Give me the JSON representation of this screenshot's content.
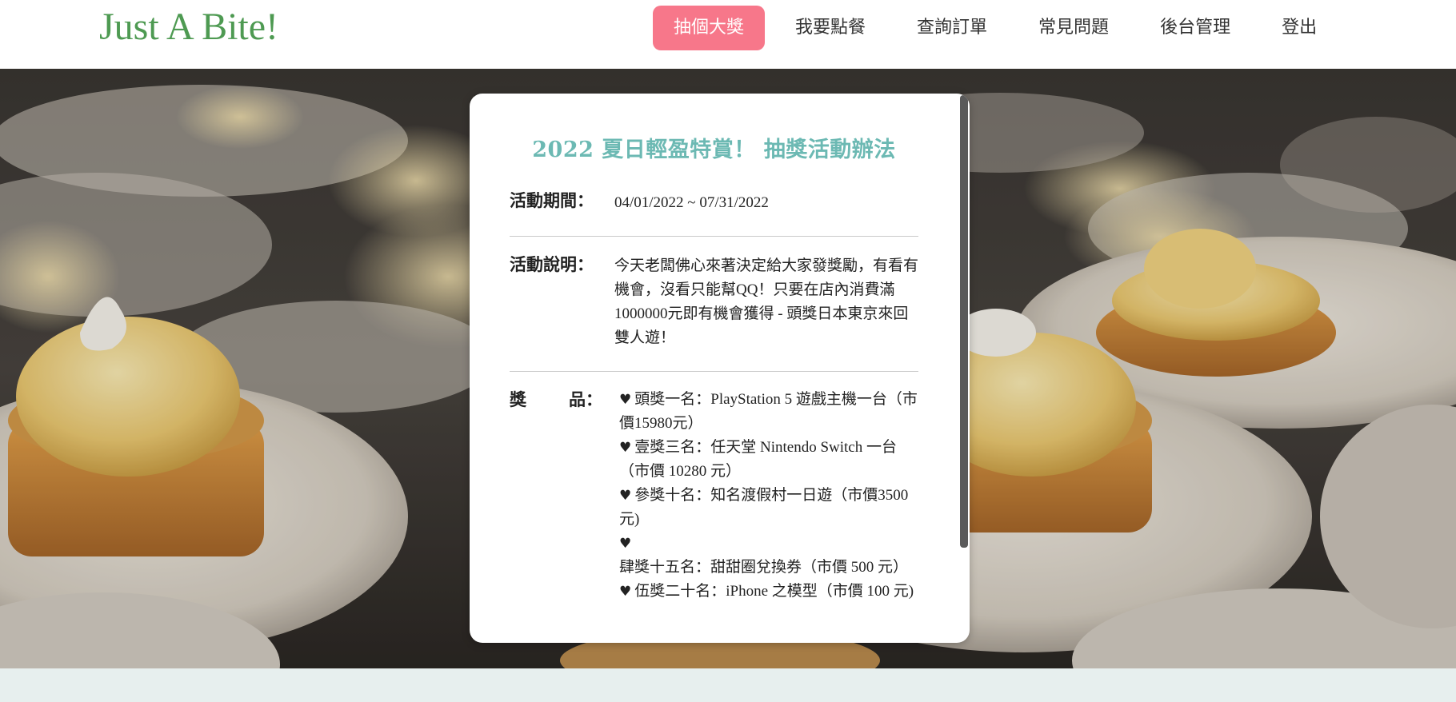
{
  "brand": {
    "name": "Just A Bite!"
  },
  "nav": {
    "items": [
      {
        "label": "抽個大獎",
        "active": true
      },
      {
        "label": "我要點餐",
        "active": false
      },
      {
        "label": "查詢訂單",
        "active": false
      },
      {
        "label": "常見問題",
        "active": false
      },
      {
        "label": "後台管理",
        "active": false
      },
      {
        "label": "登出",
        "active": false
      }
    ]
  },
  "hero": {
    "image": "lemon-tarts-on-plates-photo"
  },
  "card": {
    "title": "2022 夏日輕盈特賞！ 抽獎活動辦法",
    "period": {
      "label": "活動期間：",
      "value": "04/01/2022 ~ 07/31/2022"
    },
    "description": {
      "label": "活動說明：",
      "value": "今天老闆佛心來著決定給大家發獎勵，有看有機會，沒看只能幫QQ！只要在店內消費滿1000000元即有機會獲得 - 頭獎日本東京來回雙人遊！"
    },
    "prizes": {
      "label_first": "獎",
      "label_second": "品：",
      "icon": "heart-icon",
      "items": [
        "頭獎一名：PlayStation 5 遊戲主機一台（市價15980元）",
        "壹獎三名：任天堂 Nintendo Switch 一台（市價 10280 元）",
        "參獎十名：知名渡假村一日遊（市價3500元)",
        "肆獎十五名：甜甜圈兌換券（市價 500 元）",
        "伍獎二十名：iPhone 之模型（市價 100 元)"
      ]
    }
  },
  "colors": {
    "brand": "#4e9a52",
    "nav_active_bg": "#f7778a",
    "title": "#6cb9b3",
    "footer_band": "#e7efee"
  }
}
